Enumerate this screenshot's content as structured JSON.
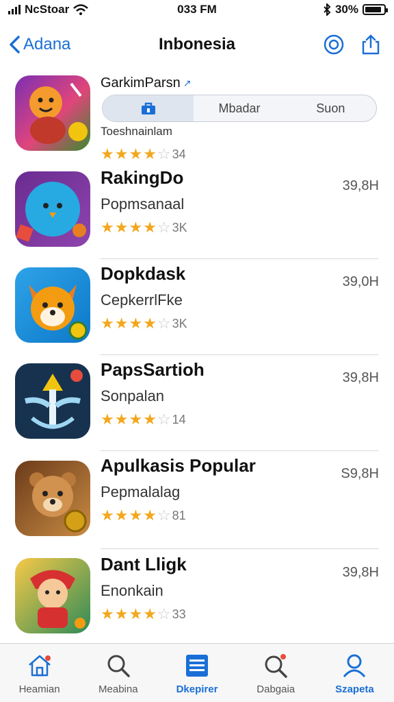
{
  "status_bar": {
    "carrier": "NcStoar",
    "time": "033 FM",
    "battery_percent": "30%",
    "battery_level": 0.9
  },
  "nav": {
    "back_label": "Adana",
    "title": "Inbonesia"
  },
  "featured": {
    "name": "GarkimParsn",
    "segments": [
      "",
      "Mbadar",
      "Suon"
    ],
    "subtitle": "Toeshnainlam",
    "rating": 4,
    "rating_count": "34"
  },
  "apps": [
    {
      "name": "RakingDo",
      "subtitle": "Popmsanaal",
      "rating": 4,
      "rating_count": "3K",
      "size": "39,8H"
    },
    {
      "name": "Dopkdask",
      "subtitle": "CepkerrlFke",
      "rating": 4,
      "rating_count": "3K",
      "size": "39,0H"
    },
    {
      "name": "PapsSartioh",
      "subtitle": "Sonpalan",
      "rating": 4,
      "rating_count": "14",
      "size": "39,8H"
    },
    {
      "name": "Apulkasis Popular",
      "subtitle": "Pepmalalag",
      "rating": 4,
      "rating_count": "81",
      "size": "S9,8H"
    },
    {
      "name": "Dant Lligk",
      "subtitle": "Enonkain",
      "rating": 4,
      "rating_count": "33",
      "size": "39,8H"
    }
  ],
  "tabs": [
    {
      "label": "Heamian",
      "icon": "home-icon"
    },
    {
      "label": "Meabina",
      "icon": "search-icon"
    },
    {
      "label": "Dkepirer",
      "icon": "list-icon",
      "active": true
    },
    {
      "label": "Dabgaia",
      "icon": "search-badge-icon"
    },
    {
      "label": "Szapeta",
      "icon": "person-icon"
    }
  ],
  "colors": {
    "accent": "#1a6fd6",
    "star": "#f2a81d"
  }
}
